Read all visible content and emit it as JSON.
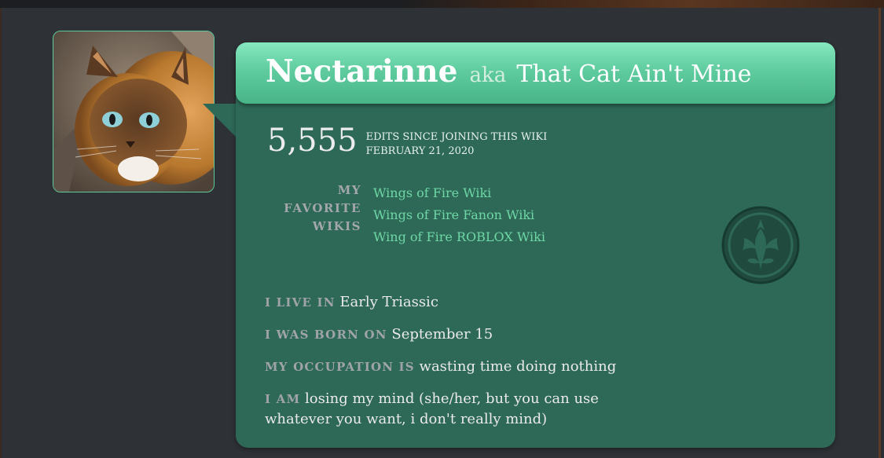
{
  "profile": {
    "username": "Nectarinne",
    "aka": "aka",
    "alias": "That Cat Ain't Mine"
  },
  "edits": {
    "count": "5,555",
    "since_line1": "EDITS SINCE JOINING THIS WIKI",
    "since_line2": "FEBRUARY 21, 2020"
  },
  "favorites": {
    "label_line1": "MY",
    "label_line2": "FAVORITE",
    "label_line3": "WIKIS",
    "items": [
      "Wings of Fire Wiki",
      "Wings of Fire Fanon Wiki",
      "Wing of Fire ROBLOX Wiki"
    ]
  },
  "details": {
    "live_label": "I LIVE IN",
    "live_value": "Early Triassic",
    "born_label": "I WAS BORN ON",
    "born_value": "September 15",
    "occupation_label": "MY OCCUPATION IS",
    "occupation_value": "wasting time doing nothing",
    "am_label": "I AM",
    "am_value": "losing my mind (she/her, but you can use whatever you want, i don't really mind)"
  },
  "icons": {
    "avatar": "cat-avatar-image",
    "emblem": "dragon-emblem-icon"
  },
  "colors": {
    "card": "#2e6957",
    "header_light": "#86e7bf",
    "header_dark": "#48b488",
    "link": "#6ed7a6",
    "background": "#2e3136"
  }
}
